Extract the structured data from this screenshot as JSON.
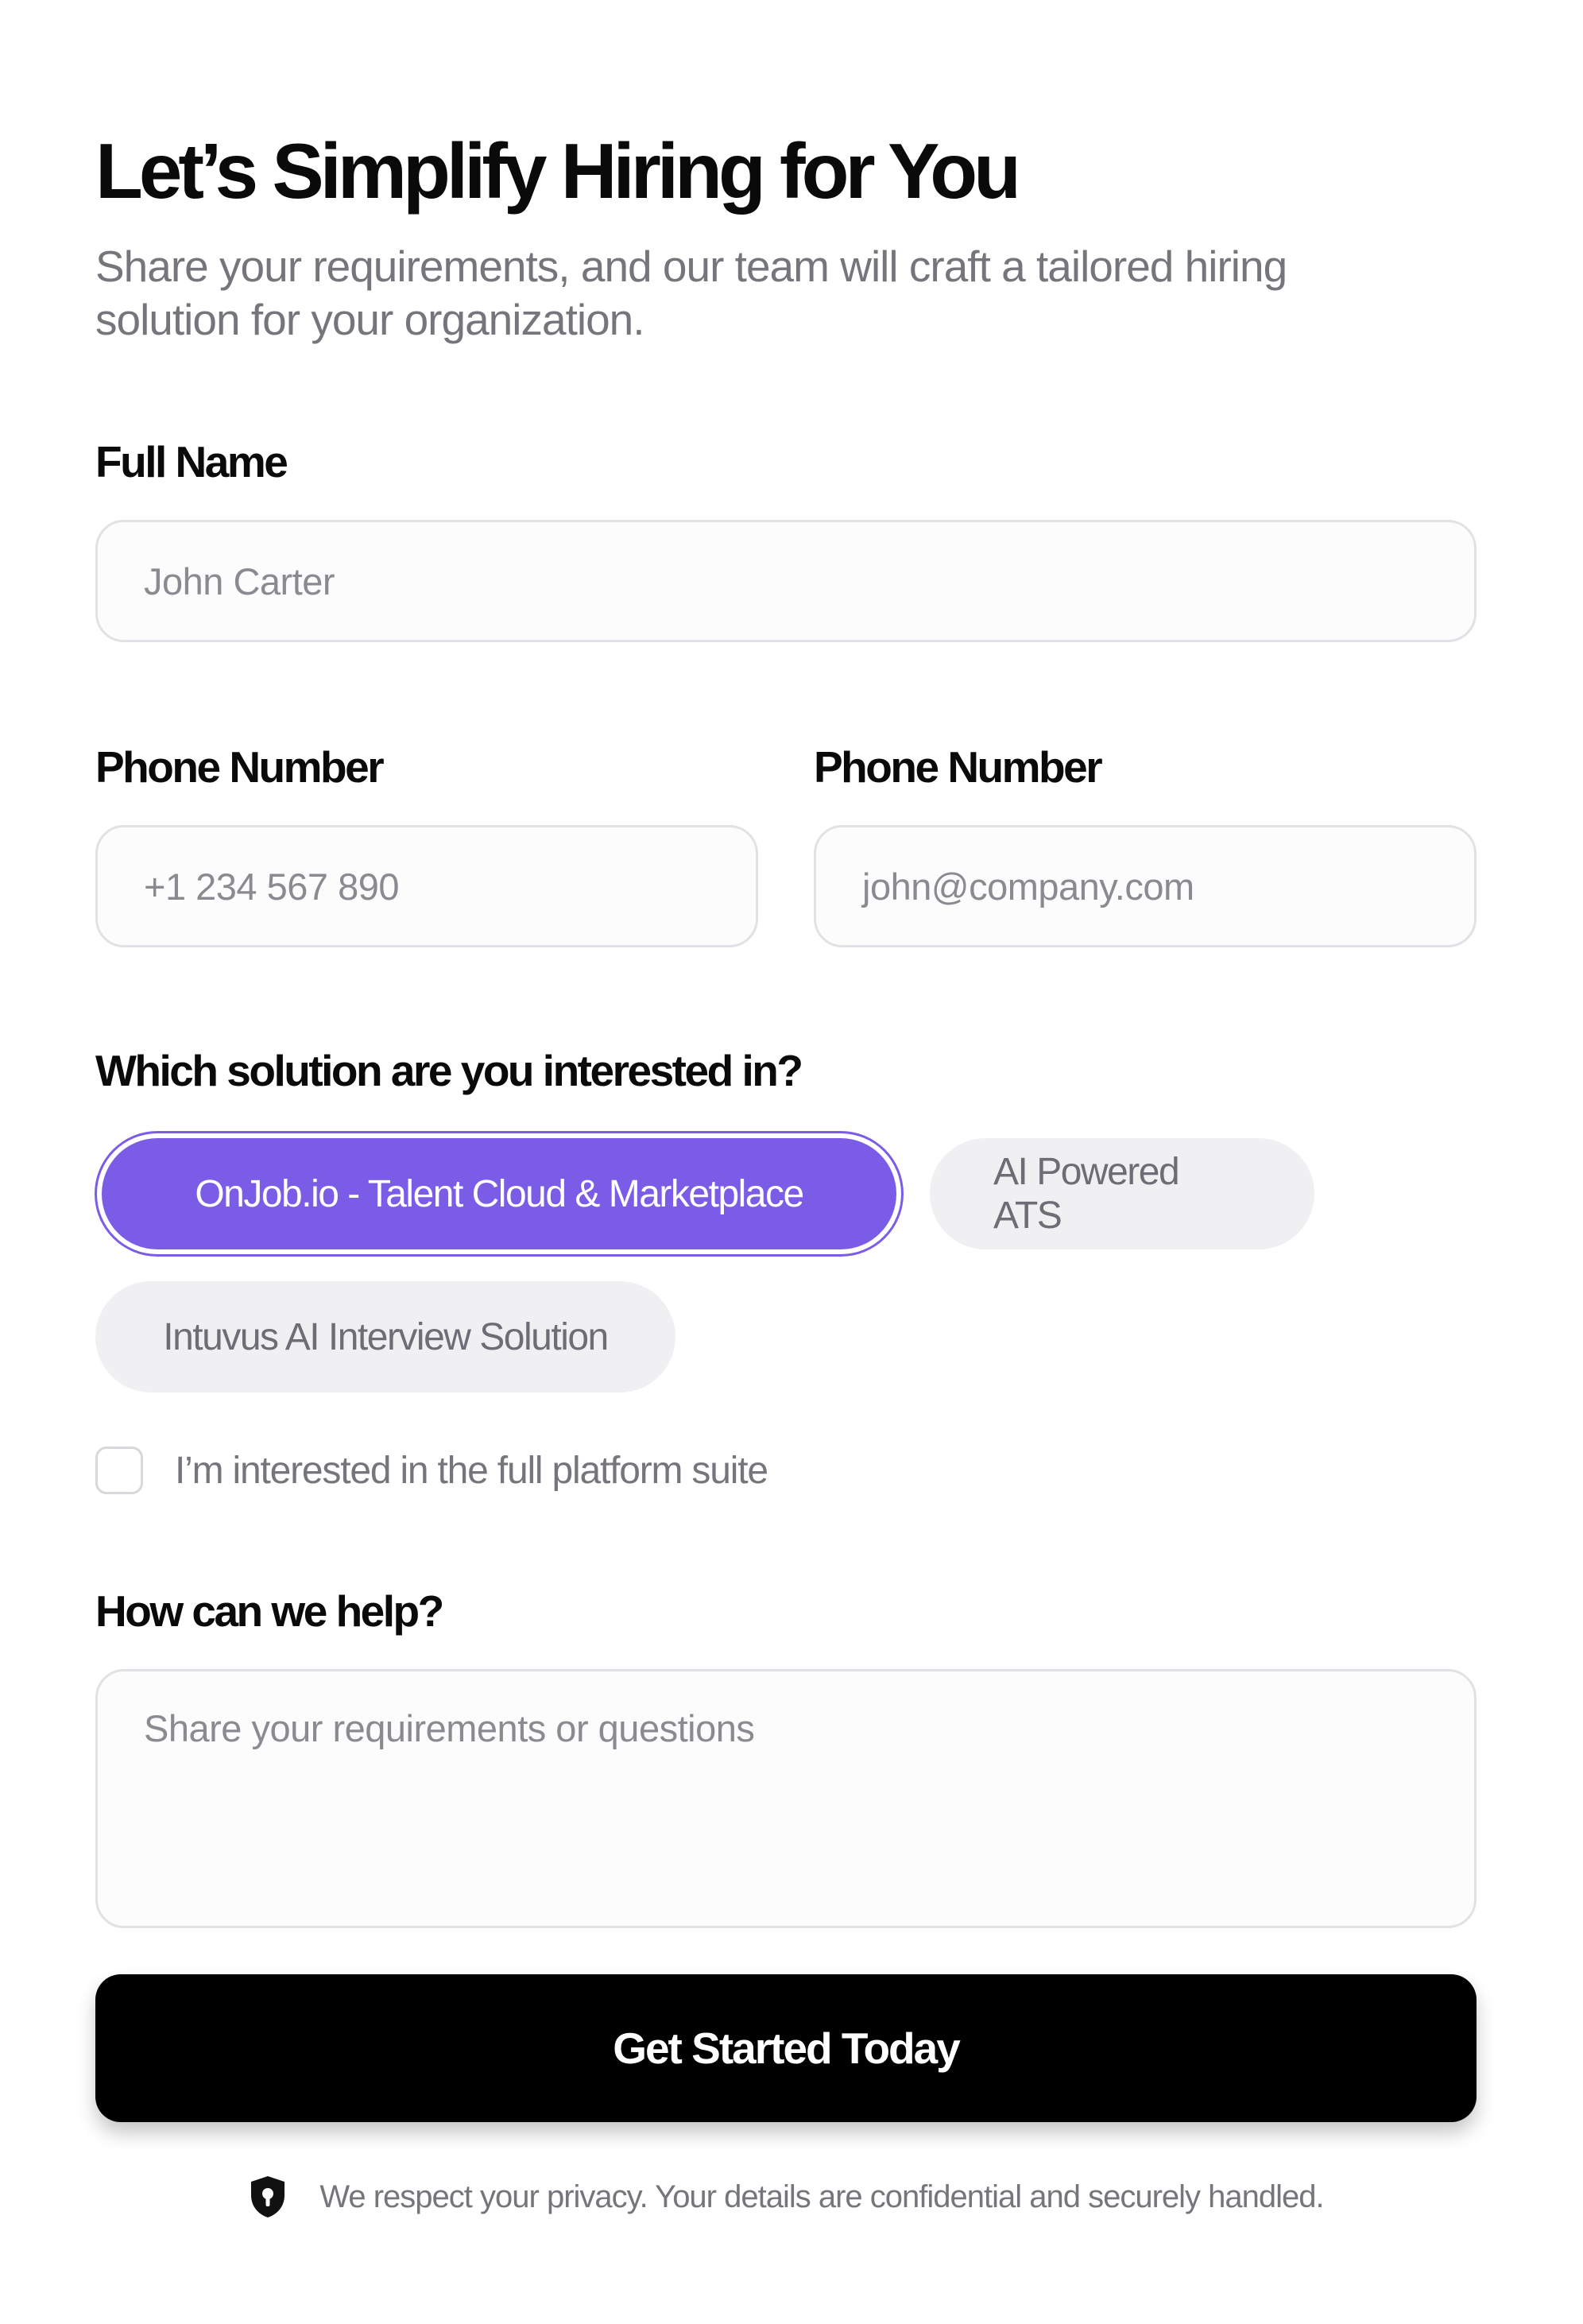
{
  "header": {
    "title": "Let’s Simplify Hiring for You",
    "subtitle": "Share your requirements, and our team will craft a tailored hiring solution for your organization."
  },
  "form": {
    "full_name": {
      "label": "Full Name",
      "placeholder": "John Carter"
    },
    "phone": {
      "label": "Phone Number",
      "placeholder": "+1 234 567 890"
    },
    "email": {
      "label": "Phone Number",
      "placeholder": "john@company.com"
    },
    "solution": {
      "label": "Which solution are you interested in?",
      "options": [
        {
          "label": "OnJob.io - Talent Cloud & Marketplace",
          "selected": true
        },
        {
          "label": "AI Powered ATS",
          "selected": false
        },
        {
          "label": "Intuvus AI Interview Solution",
          "selected": false
        }
      ]
    },
    "full_suite": {
      "label": "I’m interested in the full platform suite",
      "checked": false
    },
    "help": {
      "label": "How can we help?",
      "placeholder": "Share your requirements or questions"
    },
    "submit_label": "Get Started Today"
  },
  "privacy": {
    "icon": "shield-lock-icon",
    "text": "We respect your privacy. Your details are confidential and securely handled."
  },
  "colors": {
    "accent": "#7b5ce6",
    "cta_background": "#000000",
    "chip_background": "#f0f0f3",
    "muted_text": "#75767c"
  }
}
